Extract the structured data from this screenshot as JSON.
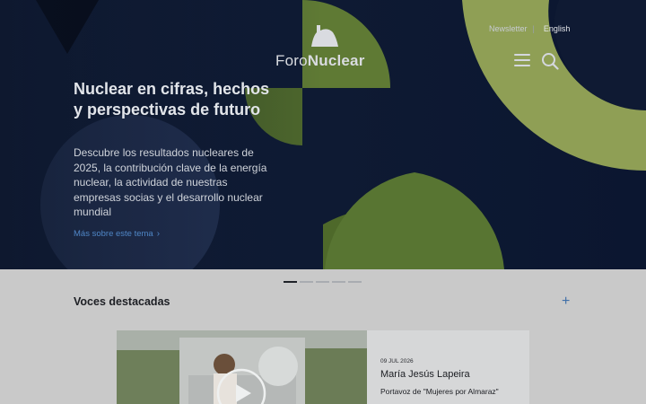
{
  "header": {
    "logo_text_light": "Foro",
    "logo_text_bold": "Nuclear",
    "newsletter_label": "Newsletter",
    "separator": "|",
    "language_label": "English"
  },
  "hero": {
    "title": "Nuclear en cifras, hechos y perspectivas de futuro",
    "description": "Descubre los resultados nucleares de 2025, la contribución clave de la energía nuclear, la actividad de nuestras empresas socias y el desarrollo nuclear mundial",
    "link_label": "Más sobre este tema",
    "link_chevron": "›"
  },
  "carousel": {
    "slides": 5,
    "active_index": 0
  },
  "section": {
    "title": "Voces destacadas",
    "plus_symbol": "+"
  },
  "card": {
    "date": "09 JUL 2026",
    "name": "María Jesús Lapeira",
    "role": "Portavoz de \"Mujeres por Almaraz\""
  },
  "colors": {
    "hero_background": "#0f1a33",
    "accent_green": "#5f7a34",
    "accent_green_light": "#8f9f55",
    "link_blue": "#4f86c6",
    "page_background": "#c9c9c9"
  },
  "icons": [
    "logo-mark-icon",
    "menu-icon",
    "search-icon",
    "chevron-right-icon",
    "plus-icon",
    "play-icon"
  ]
}
